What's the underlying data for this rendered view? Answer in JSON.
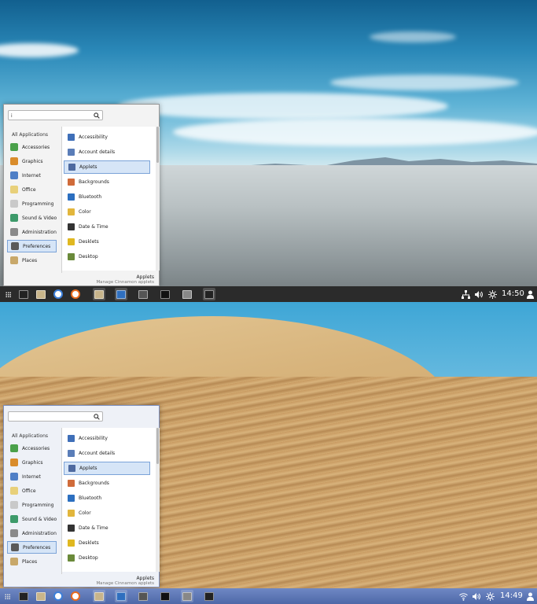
{
  "screens": [
    {
      "theme": "dark-panel",
      "menu": {
        "search_value": "i",
        "all_applications": "All Applications",
        "categories": [
          {
            "label": "Accessories",
            "icon": "accessories-icon",
            "color": "#4aa04a"
          },
          {
            "label": "Graphics",
            "icon": "graphics-icon",
            "color": "#d98c2b"
          },
          {
            "label": "Internet",
            "icon": "internet-icon",
            "color": "#4f7fc6"
          },
          {
            "label": "Office",
            "icon": "office-icon",
            "color": "#e8d07a"
          },
          {
            "label": "Programming",
            "icon": "programming-icon",
            "color": "#c9c9c9"
          },
          {
            "label": "Sound & Video",
            "icon": "sound-video-icon",
            "color": "#3d9a6a"
          },
          {
            "label": "Administration",
            "icon": "administration-icon",
            "color": "#8a8a8a"
          },
          {
            "label": "Preferences",
            "icon": "preferences-icon",
            "color": "#5a5a5a"
          },
          {
            "label": "Places",
            "icon": "places-icon",
            "color": "#c8a86a"
          }
        ],
        "active_category": "Preferences",
        "apps": [
          {
            "label": "Accessibility",
            "icon": "accessibility-icon",
            "color": "#3f6fb8"
          },
          {
            "label": "Account details",
            "icon": "account-details-icon",
            "color": "#5a7db8"
          },
          {
            "label": "Applets",
            "icon": "applets-icon",
            "color": "#4e6aa0"
          },
          {
            "label": "Backgrounds",
            "icon": "backgrounds-icon",
            "color": "#d06b3a"
          },
          {
            "label": "Bluetooth",
            "icon": "bluetooth-icon",
            "color": "#2c6fc0"
          },
          {
            "label": "Color",
            "icon": "color-icon",
            "color": "#e2b63c"
          },
          {
            "label": "Date & Time",
            "icon": "date-time-icon",
            "color": "#333333"
          },
          {
            "label": "Desklets",
            "icon": "desklets-icon",
            "color": "#e0b820"
          },
          {
            "label": "Desktop",
            "icon": "desktop-icon",
            "color": "#6a8a3a"
          }
        ],
        "active_app": "Applets",
        "description_title": "Applets",
        "description_sub": "Manage Cinnamon applets"
      },
      "panel": {
        "clock": "14:50"
      }
    },
    {
      "theme": "blue-panel",
      "menu": {
        "search_value": "",
        "all_applications": "All Applications",
        "categories": [
          {
            "label": "Accessories",
            "icon": "accessories-icon",
            "color": "#4aa04a"
          },
          {
            "label": "Graphics",
            "icon": "graphics-icon",
            "color": "#d98c2b"
          },
          {
            "label": "Internet",
            "icon": "internet-icon",
            "color": "#4f7fc6"
          },
          {
            "label": "Office",
            "icon": "office-icon",
            "color": "#e8d07a"
          },
          {
            "label": "Programming",
            "icon": "programming-icon",
            "color": "#c9c9c9"
          },
          {
            "label": "Sound & Video",
            "icon": "sound-video-icon",
            "color": "#3d9a6a"
          },
          {
            "label": "Administration",
            "icon": "administration-icon",
            "color": "#8a8a8a"
          },
          {
            "label": "Preferences",
            "icon": "preferences-icon",
            "color": "#5a5a5a"
          },
          {
            "label": "Places",
            "icon": "places-icon",
            "color": "#c8a86a"
          }
        ],
        "active_category": "Preferences",
        "apps": [
          {
            "label": "Accessibility",
            "icon": "accessibility-icon",
            "color": "#3f6fb8"
          },
          {
            "label": "Account details",
            "icon": "account-details-icon",
            "color": "#5a7db8"
          },
          {
            "label": "Applets",
            "icon": "applets-icon",
            "color": "#4e6aa0"
          },
          {
            "label": "Backgrounds",
            "icon": "backgrounds-icon",
            "color": "#d06b3a"
          },
          {
            "label": "Bluetooth",
            "icon": "bluetooth-icon",
            "color": "#2c6fc0"
          },
          {
            "label": "Color",
            "icon": "color-icon",
            "color": "#e2b63c"
          },
          {
            "label": "Date & Time",
            "icon": "date-time-icon",
            "color": "#333333"
          },
          {
            "label": "Desklets",
            "icon": "desklets-icon",
            "color": "#e0b820"
          },
          {
            "label": "Desktop",
            "icon": "desktop-icon",
            "color": "#6a8a3a"
          }
        ],
        "active_app": "Applets",
        "description_title": "Applets",
        "description_sub": "Manage Cinnamon applets"
      },
      "panel": {
        "clock": "14:49"
      }
    }
  ],
  "panel_launchers": [
    {
      "icon": "menu-grid-icon"
    },
    {
      "icon": "terminal-icon"
    },
    {
      "icon": "files-icon"
    },
    {
      "icon": "chromium-icon"
    },
    {
      "icon": "firefox-icon"
    },
    {
      "icon": "folder-window-icon"
    },
    {
      "icon": "text-editor-icon"
    },
    {
      "icon": "calculator-icon"
    },
    {
      "icon": "inkscape-icon"
    },
    {
      "icon": "screenshot-icon"
    },
    {
      "icon": "terminal-window-icon"
    }
  ],
  "tray_icons": [
    "network-icon",
    "volume-icon",
    "brightness-icon",
    "user-icon"
  ]
}
